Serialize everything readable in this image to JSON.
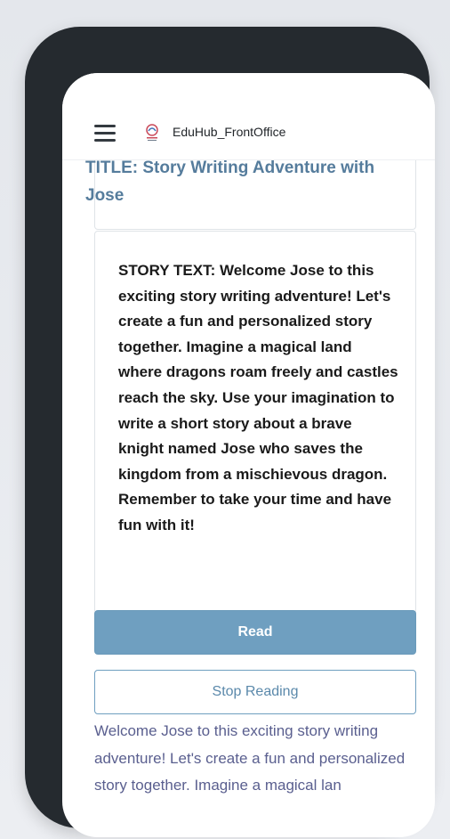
{
  "header": {
    "app_title": "EduHub_FrontOffice",
    "menu_icon": "hamburger-menu-icon",
    "logo_icon": "eduhub-logo-icon"
  },
  "story": {
    "title": "TITLE: Story Writing Adventure with Jose",
    "text": "STORY TEXT: Welcome Jose to this exciting story writing adventure! Let's create a fun and personalized story together. Imagine a magical land where dragons roam freely and castles reach the sky. Use your imagination to write a short story about a brave knight named Jose who saves the kingdom from a mischievous dragon. Remember to take your time and have fun with it!"
  },
  "actions": {
    "read_label": "Read",
    "stop_label": "Stop Reading"
  },
  "reader_output": "Welcome Jose to this exciting story writing adventure! Let's create a fun and personalized story together. Imagine a magical lan",
  "colors": {
    "title": "#557c9c",
    "primary_button": "#6f9fc0",
    "output_text": "#5a5f8f",
    "phone_frame": "#252a2f"
  }
}
